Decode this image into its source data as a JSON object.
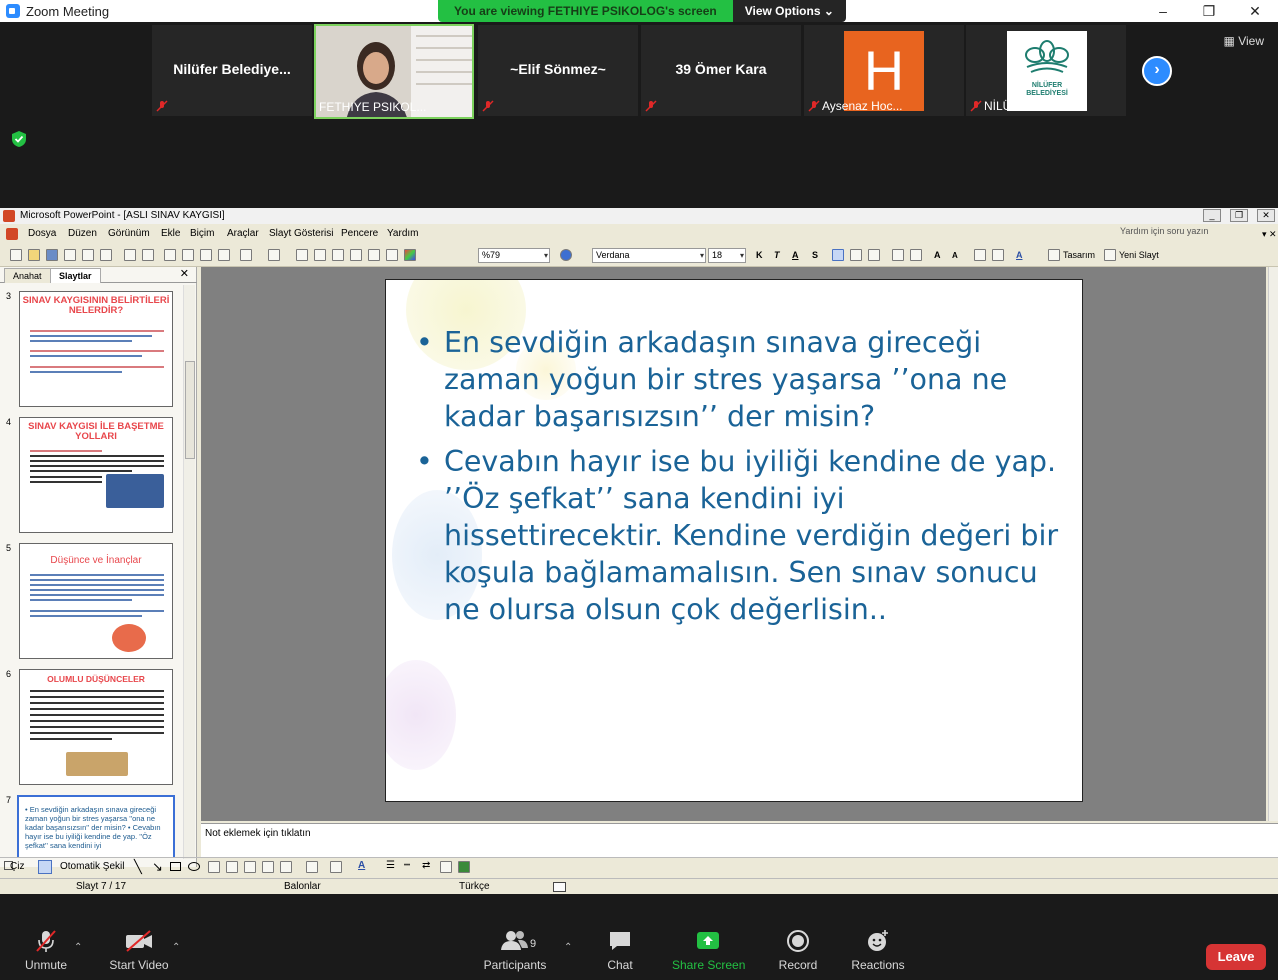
{
  "zoom": {
    "window_title": "Zoom Meeting",
    "banner_text": "You are viewing FETHIYE PSIKOLOG's screen",
    "view_options": "View Options",
    "view_label": "View",
    "participants_strip": [
      {
        "name": "Nilüfer  Belediye...",
        "label": ""
      },
      {
        "name": "",
        "label": "FETHIYE PSIKOL..."
      },
      {
        "name": "~Elif Sönmez~",
        "label": ""
      },
      {
        "name": "39 Ömer Kara",
        "label": ""
      },
      {
        "name": "",
        "label": "Aysenaz Hoc..."
      },
      {
        "name": "",
        "label": "NİLÜFER BEL..."
      }
    ],
    "avatar_letter": "H",
    "logo_text": "NİLÜFER BELEDİYESİ",
    "accent": "#2d8cff",
    "banner_color": "#23c043",
    "controls": {
      "unmute": "Unmute",
      "start_video": "Start Video",
      "participants": "Participants",
      "participants_count": "9",
      "chat": "Chat",
      "share_screen": "Share Screen",
      "record": "Record",
      "reactions": "Reactions",
      "leave": "Leave"
    }
  },
  "ppt": {
    "title": "Microsoft PowerPoint - [ASLI SINAV KAYGISI]",
    "menu": [
      "Dosya",
      "Düzen",
      "Görünüm",
      "Ekle",
      "Biçim",
      "Araçlar",
      "Slayt Gösterisi",
      "Pencere",
      "Yardım"
    ],
    "help_placeholder": "Yardım için soru yazın",
    "zoom_value": "%79",
    "font_name": "Verdana",
    "font_size": "18",
    "design_btn": "Tasarım",
    "new_slide_btn": "Yeni Slayt",
    "tabs": {
      "outline": "Anahat",
      "slides": "Slaytlar"
    },
    "thumbnails": [
      {
        "num": "3",
        "title": "SINAV KAYGISININ BELİRTİLERİ NELERDİR?"
      },
      {
        "num": "4",
        "title": "SINAV KAYGISI İLE BAŞETME YOLLARI"
      },
      {
        "num": "5",
        "title": "Düşünce ve İnançlar"
      },
      {
        "num": "6",
        "title": "OLUMLU DÜŞÜNCELER"
      },
      {
        "num": "7",
        "title": "• En sevdiğin arkadaşın sınava gireceği zaman yoğun bir stres yaşarsa ''ona ne kadar başarısızsın'' der misin? • Cevabın hayır ise bu iyiliği kendine de yap. ''Öz şefkat'' sana kendini iyi"
      }
    ],
    "slide_bullets": [
      "En sevdiğin arkadaşın sınava gireceği zaman yoğun bir stres yaşarsa ’’ona ne kadar başarısızsın’’ der misin?",
      "Cevabın hayır ise bu iyiliği kendine de yap. ’’Öz şefkat’’ sana kendini iyi hissettirecektir. Kendine verdiğin değeri bir koşula bağlamamalısın. Sen sınav sonucu ne olursa olsun çok değerlisin.."
    ],
    "notes_placeholder": "Not eklemek için tıklatın",
    "draw_label": "Çiz",
    "autoshape_label": "Otomatik Şekil",
    "status": {
      "slide": "Slayt 7 / 17",
      "design": "Balonlar",
      "language": "Türkçe"
    },
    "text_color": "#1a6397"
  }
}
